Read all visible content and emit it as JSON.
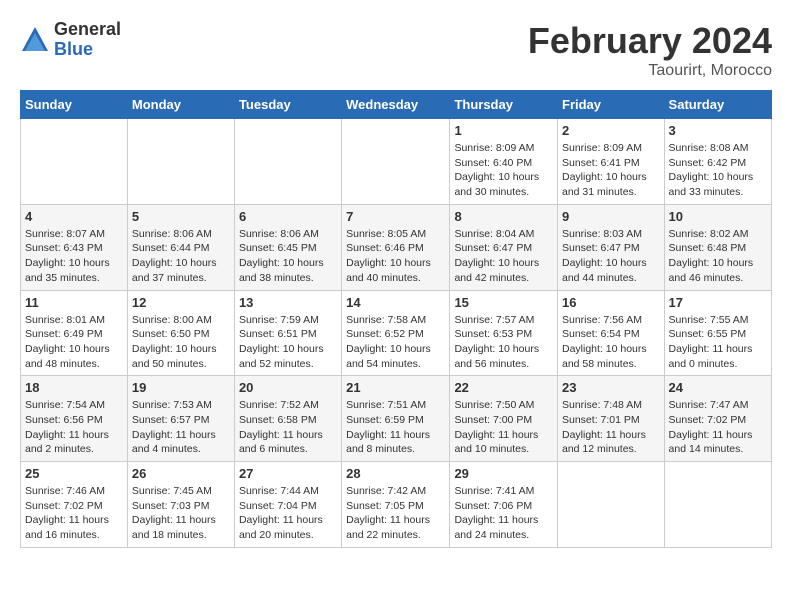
{
  "logo": {
    "general": "General",
    "blue": "Blue"
  },
  "title": "February 2024",
  "location": "Taourirt, Morocco",
  "days_of_week": [
    "Sunday",
    "Monday",
    "Tuesday",
    "Wednesday",
    "Thursday",
    "Friday",
    "Saturday"
  ],
  "weeks": [
    [
      {
        "day": "",
        "info": ""
      },
      {
        "day": "",
        "info": ""
      },
      {
        "day": "",
        "info": ""
      },
      {
        "day": "",
        "info": ""
      },
      {
        "day": "1",
        "info": "Sunrise: 8:09 AM\nSunset: 6:40 PM\nDaylight: 10 hours\nand 30 minutes."
      },
      {
        "day": "2",
        "info": "Sunrise: 8:09 AM\nSunset: 6:41 PM\nDaylight: 10 hours\nand 31 minutes."
      },
      {
        "day": "3",
        "info": "Sunrise: 8:08 AM\nSunset: 6:42 PM\nDaylight: 10 hours\nand 33 minutes."
      }
    ],
    [
      {
        "day": "4",
        "info": "Sunrise: 8:07 AM\nSunset: 6:43 PM\nDaylight: 10 hours\nand 35 minutes."
      },
      {
        "day": "5",
        "info": "Sunrise: 8:06 AM\nSunset: 6:44 PM\nDaylight: 10 hours\nand 37 minutes."
      },
      {
        "day": "6",
        "info": "Sunrise: 8:06 AM\nSunset: 6:45 PM\nDaylight: 10 hours\nand 38 minutes."
      },
      {
        "day": "7",
        "info": "Sunrise: 8:05 AM\nSunset: 6:46 PM\nDaylight: 10 hours\nand 40 minutes."
      },
      {
        "day": "8",
        "info": "Sunrise: 8:04 AM\nSunset: 6:47 PM\nDaylight: 10 hours\nand 42 minutes."
      },
      {
        "day": "9",
        "info": "Sunrise: 8:03 AM\nSunset: 6:47 PM\nDaylight: 10 hours\nand 44 minutes."
      },
      {
        "day": "10",
        "info": "Sunrise: 8:02 AM\nSunset: 6:48 PM\nDaylight: 10 hours\nand 46 minutes."
      }
    ],
    [
      {
        "day": "11",
        "info": "Sunrise: 8:01 AM\nSunset: 6:49 PM\nDaylight: 10 hours\nand 48 minutes."
      },
      {
        "day": "12",
        "info": "Sunrise: 8:00 AM\nSunset: 6:50 PM\nDaylight: 10 hours\nand 50 minutes."
      },
      {
        "day": "13",
        "info": "Sunrise: 7:59 AM\nSunset: 6:51 PM\nDaylight: 10 hours\nand 52 minutes."
      },
      {
        "day": "14",
        "info": "Sunrise: 7:58 AM\nSunset: 6:52 PM\nDaylight: 10 hours\nand 54 minutes."
      },
      {
        "day": "15",
        "info": "Sunrise: 7:57 AM\nSunset: 6:53 PM\nDaylight: 10 hours\nand 56 minutes."
      },
      {
        "day": "16",
        "info": "Sunrise: 7:56 AM\nSunset: 6:54 PM\nDaylight: 10 hours\nand 58 minutes."
      },
      {
        "day": "17",
        "info": "Sunrise: 7:55 AM\nSunset: 6:55 PM\nDaylight: 11 hours\nand 0 minutes."
      }
    ],
    [
      {
        "day": "18",
        "info": "Sunrise: 7:54 AM\nSunset: 6:56 PM\nDaylight: 11 hours\nand 2 minutes."
      },
      {
        "day": "19",
        "info": "Sunrise: 7:53 AM\nSunset: 6:57 PM\nDaylight: 11 hours\nand 4 minutes."
      },
      {
        "day": "20",
        "info": "Sunrise: 7:52 AM\nSunset: 6:58 PM\nDaylight: 11 hours\nand 6 minutes."
      },
      {
        "day": "21",
        "info": "Sunrise: 7:51 AM\nSunset: 6:59 PM\nDaylight: 11 hours\nand 8 minutes."
      },
      {
        "day": "22",
        "info": "Sunrise: 7:50 AM\nSunset: 7:00 PM\nDaylight: 11 hours\nand 10 minutes."
      },
      {
        "day": "23",
        "info": "Sunrise: 7:48 AM\nSunset: 7:01 PM\nDaylight: 11 hours\nand 12 minutes."
      },
      {
        "day": "24",
        "info": "Sunrise: 7:47 AM\nSunset: 7:02 PM\nDaylight: 11 hours\nand 14 minutes."
      }
    ],
    [
      {
        "day": "25",
        "info": "Sunrise: 7:46 AM\nSunset: 7:02 PM\nDaylight: 11 hours\nand 16 minutes."
      },
      {
        "day": "26",
        "info": "Sunrise: 7:45 AM\nSunset: 7:03 PM\nDaylight: 11 hours\nand 18 minutes."
      },
      {
        "day": "27",
        "info": "Sunrise: 7:44 AM\nSunset: 7:04 PM\nDaylight: 11 hours\nand 20 minutes."
      },
      {
        "day": "28",
        "info": "Sunrise: 7:42 AM\nSunset: 7:05 PM\nDaylight: 11 hours\nand 22 minutes."
      },
      {
        "day": "29",
        "info": "Sunrise: 7:41 AM\nSunset: 7:06 PM\nDaylight: 11 hours\nand 24 minutes."
      },
      {
        "day": "",
        "info": ""
      },
      {
        "day": "",
        "info": ""
      }
    ]
  ]
}
